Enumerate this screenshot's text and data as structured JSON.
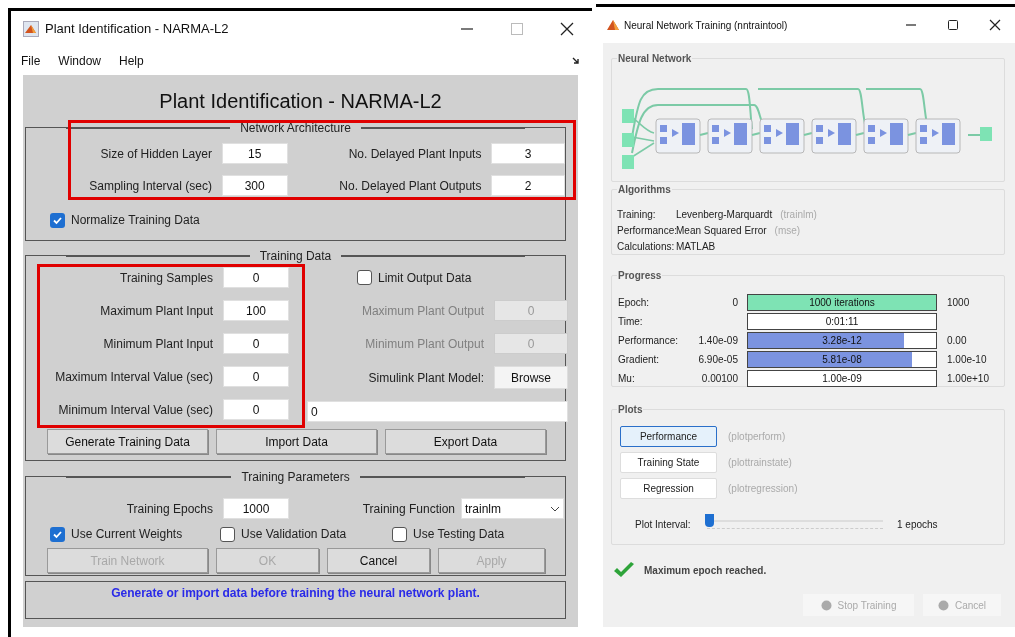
{
  "plant_window": {
    "title": "Plant Identification - NARMA-L2",
    "menu": [
      "File",
      "Window",
      "Help"
    ],
    "heading": "Plant Identification - NARMA-L2",
    "network_architecture": {
      "title": "Network Architecture",
      "rows": [
        [
          {
            "label": "Size of Hidden Layer",
            "value": "15"
          },
          {
            "label": "No. Delayed Plant Inputs",
            "value": "3"
          }
        ],
        [
          {
            "label": "Sampling Interval (sec)",
            "value": "300"
          },
          {
            "label": "No. Delayed Plant Outputs",
            "value": "2"
          }
        ]
      ],
      "normalize": {
        "label": "Normalize Training Data",
        "checked": true
      }
    },
    "training_data": {
      "title": "Training Data",
      "left_fields": [
        {
          "label": "Training Samples",
          "value": "0"
        },
        {
          "label": "Maximum Plant Input",
          "value": "100"
        },
        {
          "label": "Minimum Plant Input",
          "value": "0"
        },
        {
          "label": "Maximum Interval Value (sec)",
          "value": "0"
        },
        {
          "label": "Minimum Interval Value (sec)",
          "value": "0"
        }
      ],
      "limit_output": {
        "label": "Limit Output Data",
        "checked": false
      },
      "right_fields": [
        {
          "label": "Maximum Plant Output",
          "value": "0",
          "disabled": true
        },
        {
          "label": "Minimum Plant Output",
          "value": "0",
          "disabled": true
        }
      ],
      "simulink": {
        "label": "Simulink Plant Model:",
        "button": "Browse"
      },
      "model_path": "0",
      "buttons": [
        "Generate Training Data",
        "Import Data",
        "Export Data"
      ]
    },
    "training_parameters": {
      "title": "Training Parameters",
      "epochs": {
        "label": "Training Epochs",
        "value": "1000"
      },
      "function": {
        "label": "Training Function",
        "value": "trainlm"
      },
      "checkboxes": [
        {
          "label": "Use Current Weights",
          "checked": true
        },
        {
          "label": "Use Validation Data",
          "checked": false
        },
        {
          "label": "Use Testing Data",
          "checked": false
        }
      ],
      "buttons": [
        {
          "label": "Train Network",
          "disabled": true
        },
        {
          "label": "OK",
          "disabled": true
        },
        {
          "label": "Cancel",
          "disabled": false
        },
        {
          "label": "Apply",
          "disabled": true
        }
      ]
    },
    "status": "Generate or import data before training the neural network plant."
  },
  "training_window": {
    "title": "Neural Network Training (nntraintool)",
    "network": {
      "title": "Neural Network"
    },
    "algorithms": {
      "title": "Algorithms",
      "rows": [
        {
          "label": "Training:",
          "value": "Levenberg-Marquardt",
          "detail": "(trainlm)"
        },
        {
          "label": "Performance:",
          "value": "Mean Squared Error",
          "detail": "(mse)"
        },
        {
          "label": "Calculations:",
          "value": "MATLAB"
        }
      ]
    },
    "progress": {
      "title": "Progress",
      "rows": [
        {
          "label": "Epoch:",
          "start": "0",
          "reading": "1000 iterations",
          "end": "1000",
          "level": 1,
          "color": "#7ee3b4"
        },
        {
          "label": "Time:",
          "reading": "0:01:11"
        },
        {
          "label": "Performance:",
          "start": "1.40e-09",
          "reading": "3.28e-12",
          "end": "0.00",
          "level": 0.83,
          "color": "#7b93e0"
        },
        {
          "label": "Gradient:",
          "start": "6.90e-05",
          "reading": "5.81e-08",
          "end": "1.00e-10",
          "level": 0.87,
          "color": "#7b93e0"
        },
        {
          "label": "Mu:",
          "start": "0.00100",
          "reading": "1.00e-09",
          "end": "1.00e+10"
        }
      ]
    },
    "plots": {
      "title": "Plots",
      "buttons": [
        {
          "label": "Performance",
          "detail": "(plotperform)",
          "selected": true
        },
        {
          "label": "Training State",
          "detail": "(plottrainstate)",
          "selected": false
        },
        {
          "label": "Regression",
          "detail": "(plotregression)",
          "selected": false
        }
      ],
      "interval": {
        "label": "Plot Interval:",
        "level": 0,
        "reading": "1 epochs"
      }
    },
    "status": "Maximum epoch reached.",
    "buttons": [
      {
        "label": "Stop Training",
        "disabled": true
      },
      {
        "label": "Cancel",
        "disabled": true
      }
    ]
  }
}
